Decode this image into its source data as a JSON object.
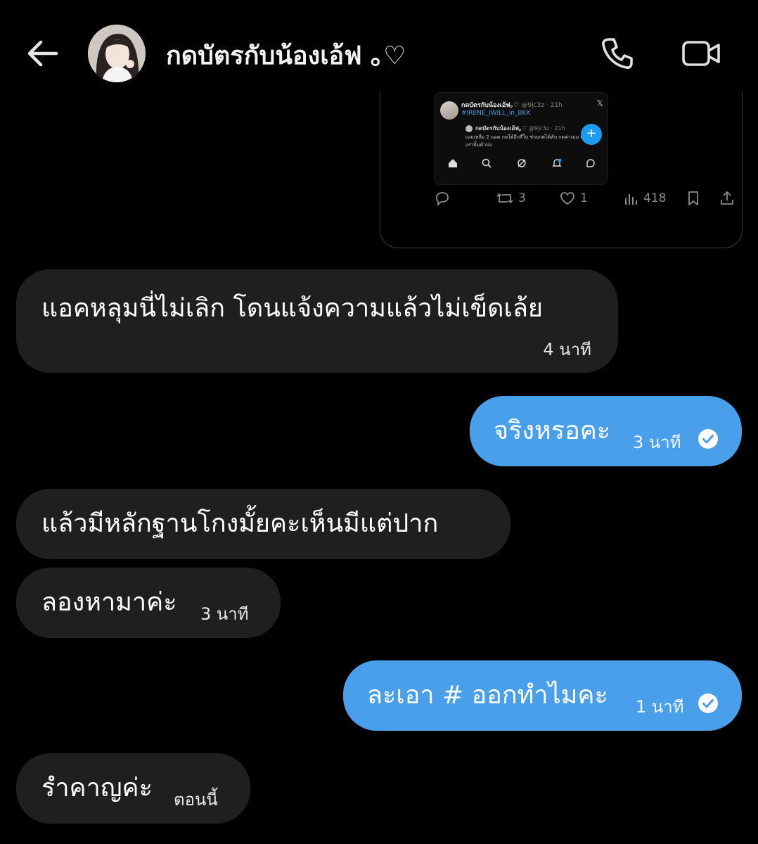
{
  "header": {
    "title": "กดบัตรกับน้องเอ้ฟ ｡♡",
    "back_icon": "arrow-left-icon",
    "call_icon": "phone-icon",
    "video_icon": "video-camera-icon"
  },
  "shared_tweet": {
    "author": "กดบัตรกับน้องเอ้ฟ｡♡",
    "handle": "@9jc3z · 21h",
    "hashtag": "#IRENE_IWILL_in_BKK",
    "inner_author": "กดบัตรกับน้องเอ้ฟ｡♡",
    "inner_handle": "@9jc3z · 21h",
    "inner_text": "เมมเหลือ 2 แอค กดได้อีกสี่ใบ ช่วยกดได้คับ กดค่าเมม แลกรีวิวเท่านั้นค้าบบ",
    "metrics": {
      "retweets": "3",
      "likes": "1",
      "views": "418"
    }
  },
  "messages": [
    {
      "direction": "in",
      "text": "แอคหลุมนี่ไม่เลิก โดนแจ้งความแล้วไม่เข็ดเล้ย",
      "time": "4 นาที"
    },
    {
      "direction": "out",
      "text": "จริงหรอคะ",
      "time": "3 นาที",
      "status_icon": "read-check-icon"
    },
    {
      "direction": "in",
      "text": "แล้วมีหลักฐานโกงมั้ยคะเห็นมีแต่ปาก",
      "time": ""
    },
    {
      "direction": "in",
      "text": "ลองหามาค่ะ",
      "time": "3 นาที"
    },
    {
      "direction": "out",
      "text": "ละเอา # ออกทำไมคะ",
      "time": "1 นาที",
      "status_icon": "read-check-icon"
    },
    {
      "direction": "in",
      "text": "รำคาญค่ะ",
      "time": "ตอนนี้"
    }
  ],
  "colors": {
    "background": "#000000",
    "incoming_bubble": "#1f1f1f",
    "outgoing_bubble": "#4a9fea",
    "twitter_blue": "#1d9bf0"
  }
}
